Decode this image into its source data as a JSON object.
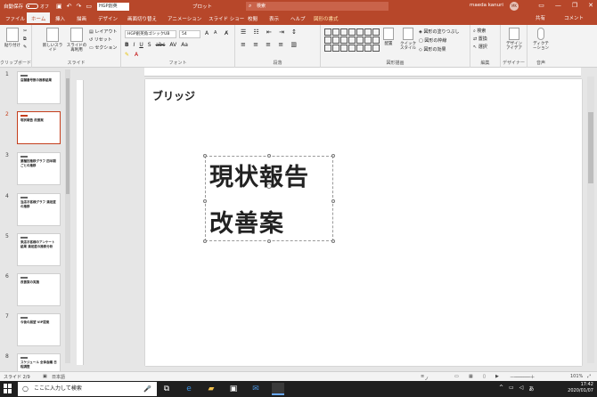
{
  "titlebar": {
    "autosave": "自動保存",
    "autosave_state": "オフ",
    "font_box": "HGP創英",
    "doc_title": "ブロット",
    "search_placeholder": "検索",
    "user": "maeda kanuri",
    "avatar": "MK"
  },
  "tabs": [
    {
      "label": "ファイル"
    },
    {
      "label": "ホーム"
    },
    {
      "label": "挿入"
    },
    {
      "label": "描画"
    },
    {
      "label": "デザイン"
    },
    {
      "label": "画面切り替え"
    },
    {
      "label": "アニメーション"
    },
    {
      "label": "スライド ショー"
    },
    {
      "label": "校閲"
    },
    {
      "label": "表示"
    },
    {
      "label": "ヘルプ"
    },
    {
      "label": "図形の書式"
    }
  ],
  "share_label": "共有",
  "comment_label": "コメント",
  "ribbon": {
    "paste": "貼り付け",
    "clipboard": "クリップボード",
    "new_slide": "新しいスライド",
    "reuse_slide": "スライドの再利用",
    "layout": "レイアウト",
    "reset": "リセット",
    "section": "セクション",
    "slides_group": "スライド",
    "font_name": "HGP創英角ゴシックUB",
    "font_size": "54",
    "font_group": "フォント",
    "paragraph_group": "段落",
    "arrange": "配置",
    "quick_styles": "クイックスタイル",
    "shape_fill": "図形の塗りつぶし",
    "shape_outline": "図形の枠線",
    "shape_effects": "図形の効果",
    "drawing_group": "図形描画",
    "find": "検索",
    "replace": "置換",
    "select": "選択",
    "editing_group": "編集",
    "designer": "デザインアイデア",
    "designer_group": "デザイナー",
    "dictate": "ディクテーション",
    "voice_group": "音声"
  },
  "thumbnails": [
    {
      "num": "1",
      "text": "店舗番号数の推移結果",
      "selected": false
    },
    {
      "num": "2",
      "text": "現状報告 改善案",
      "selected": true
    },
    {
      "num": "3",
      "text": "業種別推移グラフ 四半期ごとの推移",
      "selected": false
    },
    {
      "num": "4",
      "text": "当店お客様グラフ 満足度の推移",
      "selected": false
    },
    {
      "num": "5",
      "text": "来店お客様のアンケート結果 満足度の推移分析",
      "selected": false
    },
    {
      "num": "6",
      "text": "改善策の実施",
      "selected": false
    },
    {
      "num": "7",
      "text": "今後の展望 VIP提案",
      "selected": false
    },
    {
      "num": "8",
      "text": "スケジュール 全体会議 日程調整",
      "selected": false
    }
  ],
  "slide": {
    "title": "ブリッジ",
    "line1": "現状報告",
    "line2": "改善案"
  },
  "status": {
    "slide_count": "スライド 2/9",
    "language": "日本語",
    "notes": "ノート",
    "zoom": "101%"
  },
  "taskbar": {
    "search_placeholder": "ここに入力して検索",
    "time": "17:42",
    "date": "2020/01/07"
  }
}
